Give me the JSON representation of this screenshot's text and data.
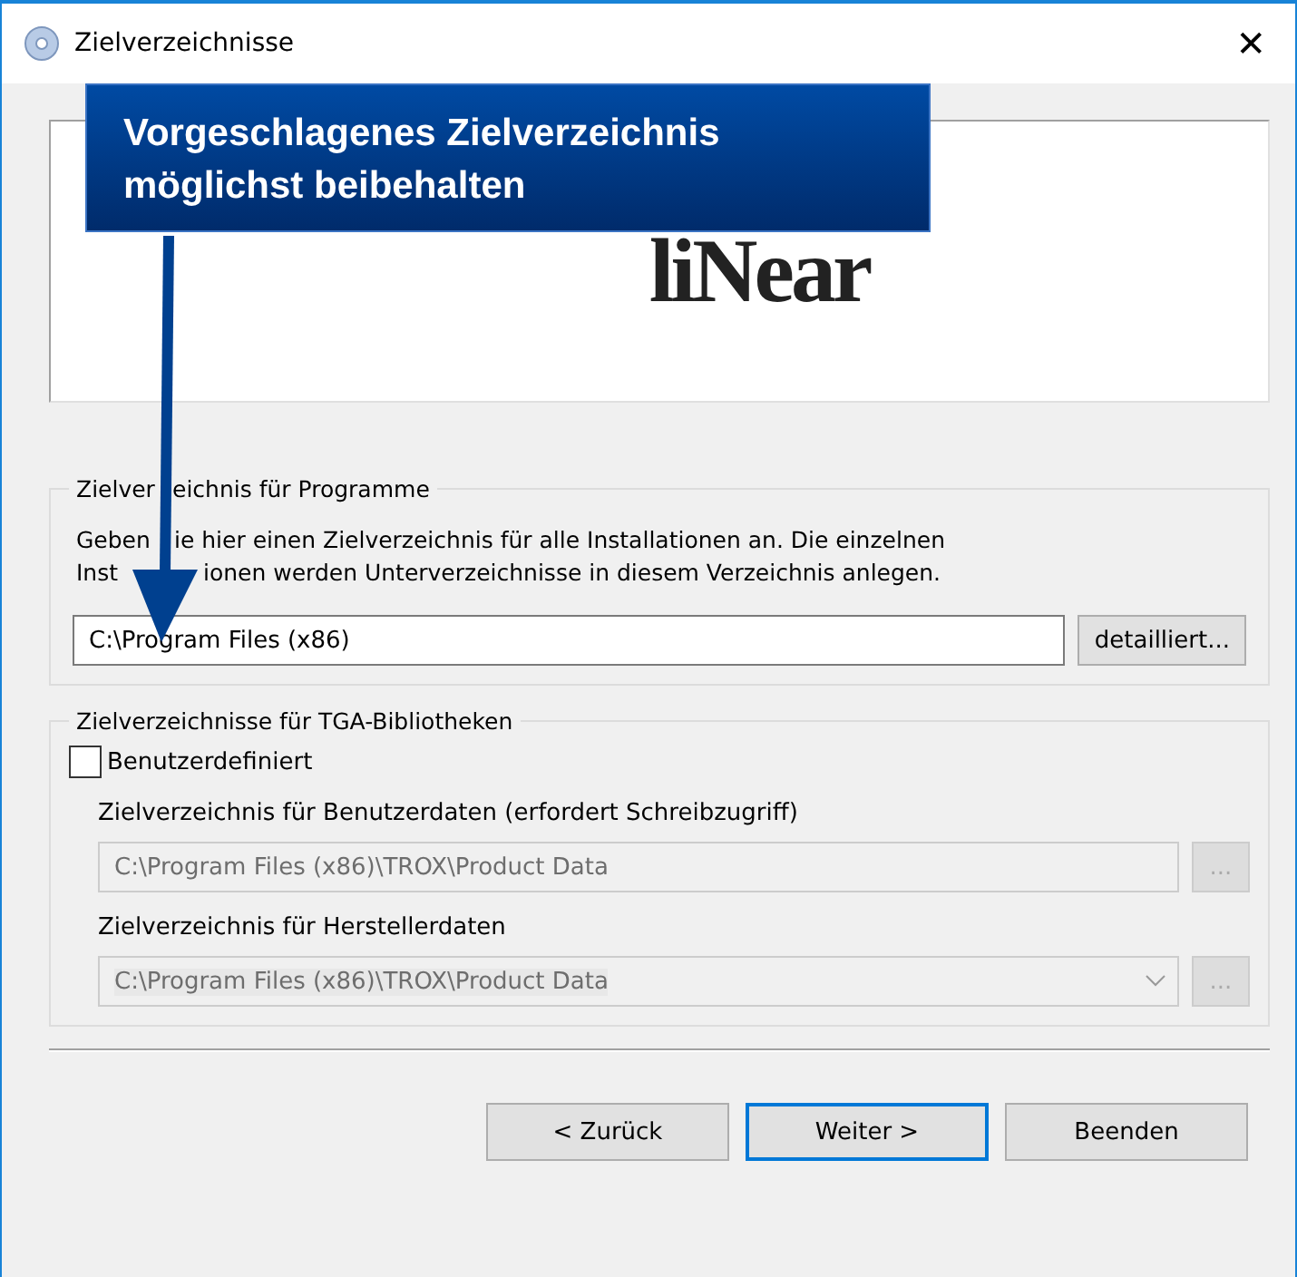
{
  "window": {
    "title": "Zielverzeichnisse",
    "close": "✕"
  },
  "banner": {
    "logo": "liNear"
  },
  "callout": {
    "text": "Vorgeschlagenes Zielverzeichnis möglichst beibehalten"
  },
  "programs_group": {
    "title_parts": [
      "Zielver",
      "eichnis für Programme"
    ],
    "description_lines": [
      [
        "Geben",
        "ie hier einen Zielverzeichnis für alle Installationen an. Die einzelnen"
      ],
      [
        "Inst",
        "ionen werden Unterverzeichnisse in diesem Verzeichnis anlegen."
      ]
    ],
    "path": "C:\\Program Files (x86)",
    "button": "detailliert..."
  },
  "libraries_group": {
    "title": "Zielverzeichnisse für TGA-Bibliotheken",
    "checkbox": {
      "label": "Benutzerdefiniert",
      "checked": false
    },
    "fields": [
      {
        "kind": "text",
        "label": "Zielverzeichnis für Benutzerdaten (erfordert Schreibzugriff)",
        "value": "C:\\Program Files (x86)\\TROX\\Product Data",
        "button": "...",
        "disabled": true
      },
      {
        "kind": "combo",
        "label": "Zielverzeichnis für Herstellerdaten",
        "value": "C:\\Program Files (x86)\\TROX\\Product Data",
        "button": "...",
        "disabled": true
      }
    ]
  },
  "buttons": [
    {
      "label": "< Zurück",
      "selected": false
    },
    {
      "label": "Weiter >",
      "selected": true
    },
    {
      "label": "Beenden",
      "selected": false
    }
  ]
}
